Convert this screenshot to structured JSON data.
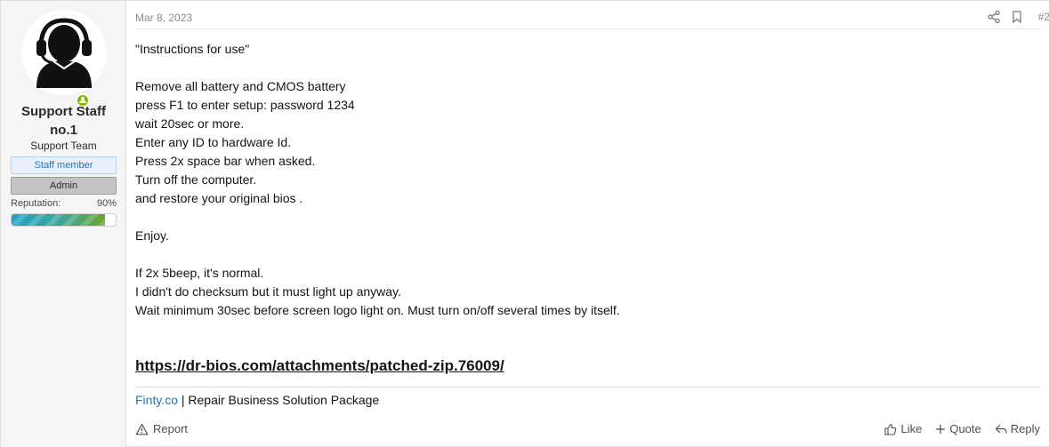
{
  "user": {
    "name": "Support Staff no.1",
    "title": "Support Team",
    "badges": [
      "Staff member",
      "Admin"
    ],
    "reputation_label": "Reputation:",
    "reputation_value": "90%",
    "reputation_fraction": 0.9,
    "online": true,
    "avatar_icon": "support-headset-person-icon"
  },
  "post": {
    "date": "Mar 8, 2023",
    "number": "#2",
    "header_icons": [
      "share-icon",
      "bookmark-icon"
    ],
    "lines": [
      "\"Instructions for use\"",
      "",
      "Remove all battery and CMOS battery",
      "press F1 to enter setup: password 1234",
      "wait 20sec or more.",
      "Enter any ID to hardware Id.",
      "Press 2x space bar when asked.",
      "Turn off the computer.",
      "and restore your original bios .",
      "",
      "Enjoy.",
      "",
      "If 2x 5beep, it's normal.",
      "I didn't do checksum but it must light up anyway.",
      "Wait minimum 30sec before screen logo light on. Must turn on/off several times by itself."
    ],
    "link": "https://dr-bios.com/attachments/patched-zip.76009/"
  },
  "signature": {
    "link_text": "Finty.co",
    "separator": " | ",
    "text": "Repair Business Solution Package"
  },
  "footer": {
    "report": "Report",
    "like": "Like",
    "quote": "Quote",
    "reply": "Reply"
  },
  "colors": {
    "accent_link": "#2577b1",
    "online": "#7fb900",
    "staff_badge_bg": "#e8f1fb",
    "admin_badge_bg": "#c4c4c4"
  }
}
